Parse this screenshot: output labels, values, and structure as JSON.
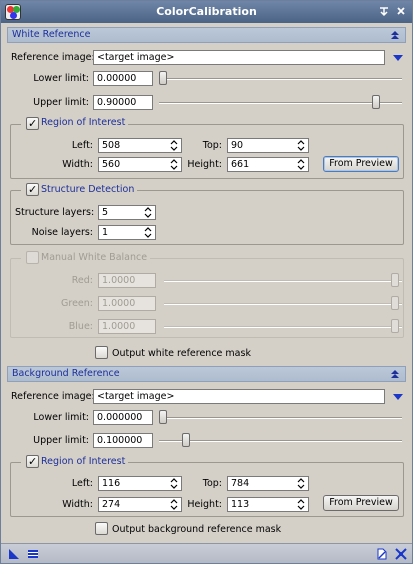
{
  "window": {
    "title": "ColorCalibration"
  },
  "white_reference": {
    "header": "White Reference",
    "reference_image_label": "Reference image:",
    "reference_image_value": "<target image>",
    "lower_limit_label": "Lower limit:",
    "lower_limit_value": "0.00000",
    "lower_limit_fraction": 0.0,
    "upper_limit_label": "Upper limit:",
    "upper_limit_value": "0.90000",
    "upper_limit_fraction": 0.9,
    "roi": {
      "title": "Region of Interest",
      "left_label": "Left:",
      "left_value": "508",
      "top_label": "Top:",
      "top_value": "90",
      "width_label": "Width:",
      "width_value": "560",
      "height_label": "Height:",
      "height_value": "661",
      "from_preview": "From Preview"
    },
    "structure": {
      "title": "Structure Detection",
      "layers_label": "Structure layers:",
      "layers_value": "5",
      "noise_label": "Noise layers:",
      "noise_value": "1"
    },
    "manual_wb": {
      "title": "Manual White Balance",
      "red_label": "Red:",
      "red_value": "1.0000",
      "green_label": "Green:",
      "green_value": "1.0000",
      "blue_label": "Blue:",
      "blue_value": "1.0000"
    },
    "output_mask_label": "Output white reference mask"
  },
  "background_reference": {
    "header": "Background Reference",
    "reference_image_label": "Reference image:",
    "reference_image_value": "<target image>",
    "lower_limit_label": "Lower limit:",
    "lower_limit_value": "0.000000",
    "lower_limit_fraction": 0.0,
    "upper_limit_label": "Upper limit:",
    "upper_limit_value": "0.100000",
    "upper_limit_fraction": 0.1,
    "roi": {
      "title": "Region of Interest",
      "left_label": "Left:",
      "left_value": "116",
      "top_label": "Top:",
      "top_value": "784",
      "width_label": "Width:",
      "width_value": "274",
      "height_label": "Height:",
      "height_value": "113",
      "from_preview": "From Preview"
    },
    "output_mask_label": "Output background reference mask"
  },
  "icons": {
    "titlebar": [
      "app-icon",
      "pin-icon",
      "close-icon"
    ],
    "section": [
      "collapse-up-icon",
      "combo-arrow-icon"
    ],
    "bottombar": [
      "new-instance-icon",
      "global-apply-icon",
      "documentation-icon",
      "reset-icon"
    ]
  },
  "colors": {
    "accent": "#1d2f9a",
    "titlebar": "#5a7090",
    "combo_arrow": "#1a37c9"
  }
}
